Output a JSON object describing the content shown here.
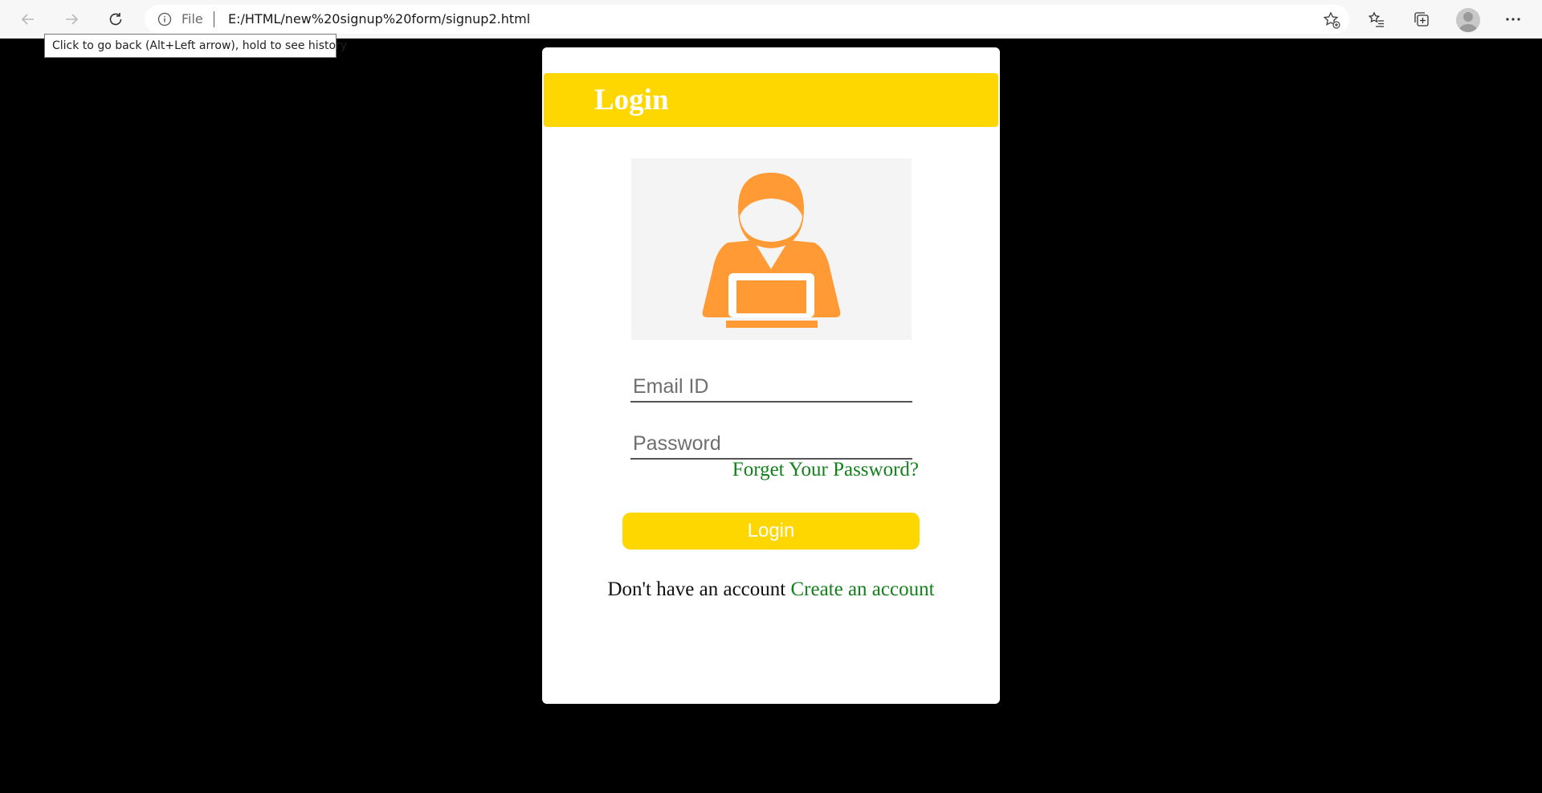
{
  "browser": {
    "scheme_label": "File",
    "url": "E:/HTML/new%20signup%20form/signup2.html",
    "tooltip": "Click to go back (Alt+Left arrow), hold to see history"
  },
  "login_card": {
    "title": "Login",
    "email_placeholder": "Email ID",
    "password_placeholder": "Password",
    "forgot_link": "Forget Your Password?",
    "login_button": "Login",
    "signup_prompt": "Don't have an account",
    "signup_link": "Create an account"
  },
  "colors": {
    "page_background": "#000000",
    "accent_yellow": "#ffd700",
    "link_green": "#14801c",
    "avatar_orange": "#ff9a35"
  }
}
